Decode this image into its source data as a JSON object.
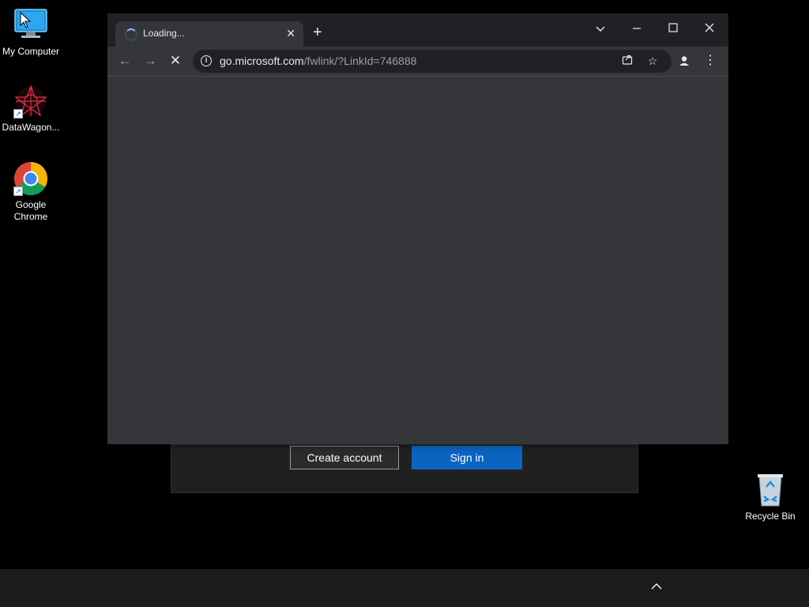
{
  "desktop": {
    "icons": [
      {
        "label": "My Computer",
        "icon": "computer-icon"
      },
      {
        "label": "DataWagon...",
        "icon": "datawagon-icon"
      },
      {
        "label": "Google Chrome",
        "icon": "chrome-icon"
      },
      {
        "label": "Recycle Bin",
        "icon": "recycle-bin-icon"
      }
    ]
  },
  "background_dialog": {
    "create_account_label": "Create account",
    "sign_in_label": "Sign in"
  },
  "browser": {
    "tab": {
      "title": "Loading...",
      "close_glyph": "✕"
    },
    "new_tab_glyph": "+",
    "window_controls": {
      "tab_search": "⌄",
      "minimize": "—",
      "maximize": "☐",
      "close": "✕"
    },
    "address": {
      "host": "go.microsoft.com",
      "path": "/fwlink/?LinkId=746888"
    },
    "nav": {
      "back": "←",
      "forward": "→",
      "stop": "✕"
    }
  },
  "colors": {
    "accent_blue": "#0b63c2",
    "spinner_blue": "#8ab4f8"
  }
}
